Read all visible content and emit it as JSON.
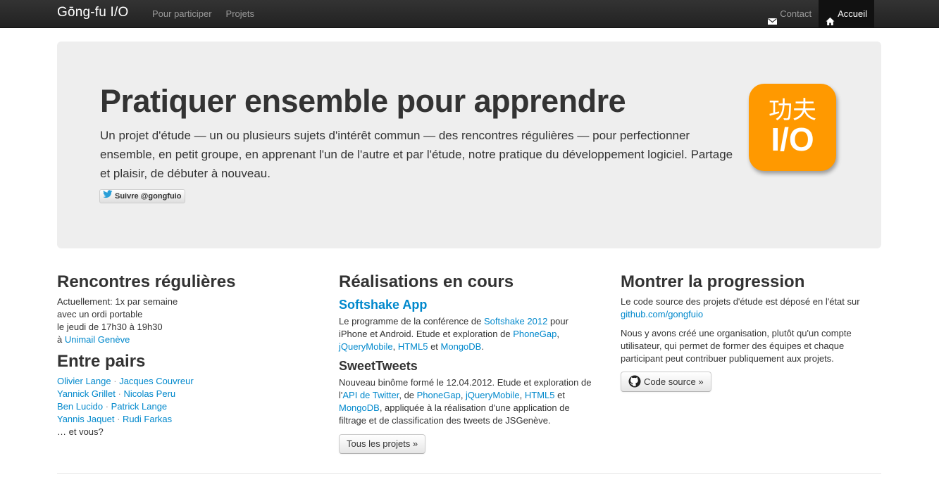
{
  "navbar": {
    "brand": "Gōng-fu I/O",
    "left_links": [
      "Pour participer",
      "Projets"
    ],
    "contact": "Contact",
    "home": "Accueil",
    "contact_icon": "envelope-icon",
    "home_icon": "home-icon"
  },
  "hero": {
    "title": "Pratiquer ensemble pour apprendre",
    "lead": "Un projet d'étude — un ou plusieurs sujets d'intérêt commun — des rencontres régulières — pour perfectionner ensemble, en petit groupe, en apprenant l'un de l'autre et par l'étude, notre pratique du développement logiciel. Partage et plaisir, de débuter à nouveau.",
    "follow_button": "Suivre @gongfuio",
    "logo_han": "功夫",
    "logo_io": "I/O",
    "logo_color": "#ff9900"
  },
  "meetings": {
    "title": "Rencontres régulières",
    "lines": [
      "Actuellement: 1x par semaine",
      "avec un ordi portable",
      "le jeudi de 17h30 à 19h30"
    ],
    "place_prefix": "à ",
    "place_link": "Unimail Genève"
  },
  "peers": {
    "title": "Entre pairs",
    "pairs": [
      [
        "Olivier Lange",
        "Jacques Couvreur"
      ],
      [
        "Yannick Grillet",
        "Nicolas Peru"
      ],
      [
        "Ben Lucido",
        "Patrick Lange"
      ],
      [
        "Yannis Jaquet",
        "Rudi Farkas"
      ]
    ],
    "separator": "·",
    "and_you": "… et vous?"
  },
  "projects": {
    "title": "Réalisations en cours",
    "softshake": {
      "title": "Softshake App",
      "t1": "Le programme de la conférence de ",
      "l1": "Softshake 2012",
      "t2": " pour iPhone et Android. Etude et exploration de ",
      "l2": "PhoneGap",
      "t3": ", ",
      "l3": "jQueryMobile",
      "t4": ", ",
      "l4": "HTML5",
      "t5": " et ",
      "l5": "MongoDB",
      "t6": "."
    },
    "sweettweets": {
      "title": "SweetTweets",
      "t1": "Nouveau binôme formé le 12.04.2012. Etude et exploration de l'",
      "l1": "API de Twitter",
      "t2": ", de ",
      "l2": "PhoneGap",
      "t3": ", ",
      "l3": "jQueryMobile",
      "t4": ", ",
      "l4": "HTML5",
      "t5": " et ",
      "l5": "MongoDB",
      "t6": ", appliquée à la réalisation d'une application de filtrage et de classification des tweets de JSGenève."
    },
    "all_button": "Tous les projets »"
  },
  "progress": {
    "title": "Montrer la progression",
    "p1": "Le code source des projets d'étude est déposé en l'état sur",
    "p1_link": "github.com/gongfuio",
    "p2": "Nous y avons créé une organisation, plutôt qu'un compte utilisateur, qui permet de former des équipes et chaque participant peut contribuer publiquement aux projets.",
    "button": "Code source »",
    "button_icon": "github-icon"
  }
}
